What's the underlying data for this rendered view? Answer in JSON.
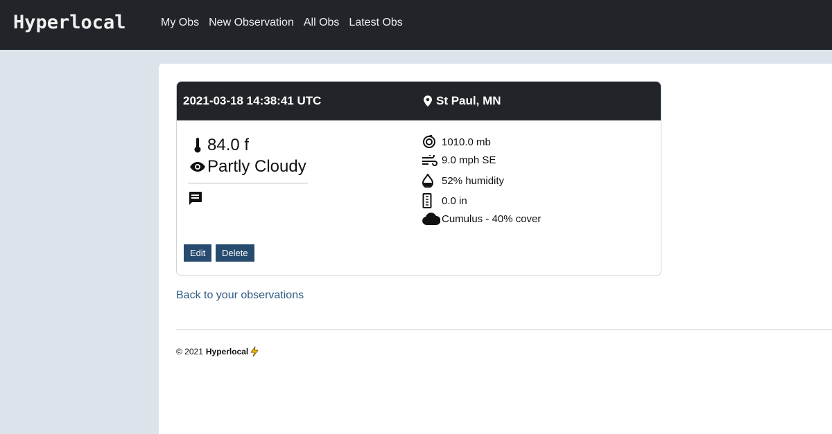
{
  "navbar": {
    "brand": "Hyperlocal",
    "links": [
      "My Obs",
      "New Observation",
      "All Obs",
      "Latest Obs"
    ]
  },
  "observation": {
    "datetime": "2021-03-18 14:38:41 UTC",
    "location": "St Paul, MN",
    "temperature": "84.0 f",
    "condition": "Partly Cloudy",
    "pressure": "1010.0 mb",
    "wind": "9.0 mph SE",
    "humidity": "52% humidity",
    "precipitation": "0.0 in",
    "clouds": "Cumulus - 40% cover"
  },
  "actions": {
    "edit": "Edit",
    "delete": "Delete"
  },
  "back_link": "Back to your observations",
  "footer": {
    "copyright": "© 2021",
    "brand": "Hyperlocal"
  },
  "icons": [
    "map-pin-icon",
    "thermometer-icon",
    "eye-icon",
    "comment-icon",
    "pressure-icon",
    "wind-icon",
    "humidity-drop-icon",
    "rain-gauge-icon",
    "cloud-icon",
    "lightning-icon"
  ],
  "colors": {
    "navbar": "#212529",
    "button": "#264b6e",
    "link": "#2f5b84",
    "background": "#dce3ea",
    "lightning": "#e0a800"
  }
}
